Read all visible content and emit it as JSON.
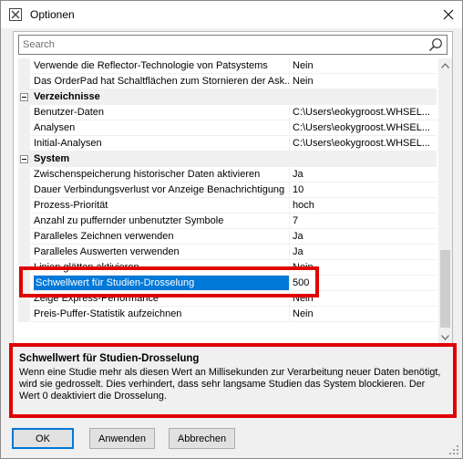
{
  "window": {
    "title": "Optionen",
    "close_glyph": "✕"
  },
  "search": {
    "placeholder": "Search",
    "value": ""
  },
  "properties": {
    "top_rows": [
      {
        "name": "Verwende die Reflector-Technologie von Patsystems",
        "value": "Nein"
      },
      {
        "name": "Das OrderPad hat Schaltflächen zum Stornieren der Ask...",
        "value": "Nein"
      }
    ],
    "category_verzeichnisse": "Verzeichnisse",
    "verzeichnisse_rows": [
      {
        "name": "Benutzer-Daten",
        "value": "C:\\Users\\eokygroost.WHSEL..."
      },
      {
        "name": "Analysen",
        "value": "C:\\Users\\eokygroost.WHSEL..."
      },
      {
        "name": "Initial-Analysen",
        "value": "C:\\Users\\eokygroost.WHSEL..."
      }
    ],
    "category_system": "System",
    "system_rows": [
      {
        "name": "Zwischenspeicherung historischer Daten aktivieren",
        "value": "Ja"
      },
      {
        "name": "Dauer Verbindungsverlust vor Anzeige Benachrichtigung",
        "value": "10"
      },
      {
        "name": "Prozess-Priorität",
        "value": "hoch"
      },
      {
        "name": "Anzahl zu puffernder unbenutzter Symbole",
        "value": "7"
      },
      {
        "name": "Paralleles Zeichnen verwenden",
        "value": "Ja"
      },
      {
        "name": "Paralleles Auswerten verwenden",
        "value": "Ja"
      },
      {
        "name": "Linien glätten aktivieren",
        "value": "Nein"
      },
      {
        "name": "Schwellwert für Studien-Drosselung",
        "value": "500"
      },
      {
        "name": "Zeige Express-Performance",
        "value": "Nein"
      },
      {
        "name": "Preis-Puffer-Statistik aufzeichnen",
        "value": "Nein"
      }
    ]
  },
  "description": {
    "title": "Schwellwert für Studien-Drosselung",
    "text": "Wenn eine Studie mehr als diesen Wert an Millisekunden zur Verarbeitung neuer Daten benötigt, wird sie gedrosselt. Dies verhindert, dass sehr langsame Studien das System blockieren. Der Wert 0 deaktiviert die Drosselung."
  },
  "buttons": {
    "ok": "OK",
    "apply": "Anwenden",
    "cancel": "Abbrechen"
  },
  "colors": {
    "selection": "#0078d7",
    "highlight_box": "#e00000"
  }
}
